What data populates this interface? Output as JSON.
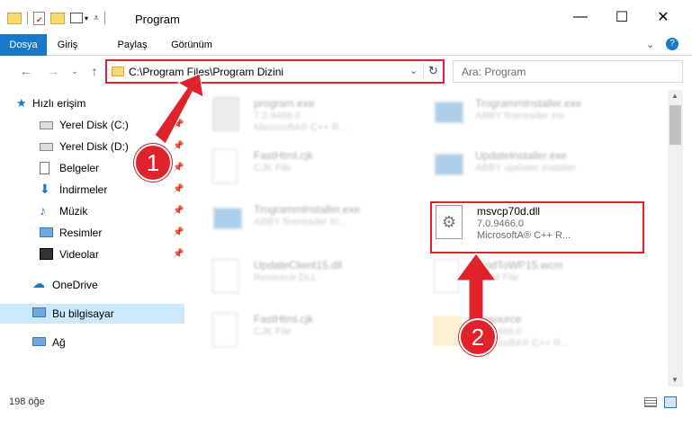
{
  "window": {
    "title": "Program",
    "minimize": "—",
    "maximize": "☐",
    "close": "✕"
  },
  "ribbon": {
    "tabs": [
      "Dosya",
      "Giriş",
      "Paylaş",
      "Görünüm"
    ],
    "active_tab": "Dosya",
    "accent_color": "#1979ca"
  },
  "navigation": {
    "path": "C:\\Program Files\\Program Dizini",
    "search_placeholder": "Ara: Program"
  },
  "sidebar": {
    "items": [
      {
        "label": "Hızlı erişim",
        "icon": "star-icon",
        "pinned": false
      },
      {
        "label": "Yerel Disk (C:)",
        "icon": "drive-icon",
        "pinned": true
      },
      {
        "label": "Yerel Disk (D:)",
        "icon": "drive-icon",
        "pinned": true
      },
      {
        "label": "Belgeler",
        "icon": "document-icon",
        "pinned": true
      },
      {
        "label": "İndirmeler",
        "icon": "download-icon",
        "pinned": true
      },
      {
        "label": "Müzik",
        "icon": "music-icon",
        "pinned": true
      },
      {
        "label": "Resimler",
        "icon": "pictures-icon",
        "pinned": true
      },
      {
        "label": "Videolar",
        "icon": "video-icon",
        "pinned": true
      },
      {
        "label": "OneDrive",
        "icon": "cloud-icon",
        "pinned": false
      },
      {
        "label": "Bu bilgisayar",
        "icon": "computer-icon",
        "pinned": false,
        "selected": true
      },
      {
        "label": "Ağ",
        "icon": "network-icon",
        "pinned": false
      }
    ]
  },
  "files": [
    {
      "name": "program.exe",
      "line2": "7.0.9466.0",
      "line3": "MicrosoftA® C++ R...",
      "icon": "exe-icon",
      "faded": true
    },
    {
      "name": "Trogrammlnstaller.exe",
      "line2": "ABBY finereader ins",
      "line3": "",
      "icon": "installer-icon",
      "faded": true
    },
    {
      "name": "FastHtml.cjk",
      "line2": "CJK File",
      "line3": "",
      "icon": "blank-file-icon",
      "faded": true
    },
    {
      "name": "Updatelnstaller.exe",
      "line2": "ABBY updatec installer",
      "line3": "",
      "icon": "installer-icon",
      "faded": true
    },
    {
      "name": "Trogrammlnstaller.exe",
      "line2": "ABBY finereader tri...",
      "line3": "",
      "icon": "installer-icon",
      "faded": true
    },
    {
      "name": "msvcp70d.dll",
      "line2": "7.0.9466.0",
      "line3": "MicrosoftA® C++ R...",
      "icon": "dll-gear-icon",
      "faded": false
    },
    {
      "name": "UpdateClient15.dll",
      "line2": "Resource DLL",
      "line3": "",
      "icon": "dll-gear-icon",
      "faded": true
    },
    {
      "name": "BindToWP15.wcm",
      "line2": "WCM File",
      "line3": "",
      "icon": "blank-file-icon",
      "faded": true
    },
    {
      "name": "FastHtml.cjk",
      "line2": "CJK File",
      "line3": "",
      "icon": "blank-file-icon",
      "faded": true
    },
    {
      "name": "Resource",
      "line2": "7.0.9466.0",
      "line3": "MicrosoftA® C++ R...",
      "icon": "folder-icon",
      "faded": true
    }
  ],
  "status": {
    "item_count": "198 öğe"
  },
  "annotations": {
    "step1": "1",
    "step2": "2",
    "highlight_color": "#e0232b"
  }
}
